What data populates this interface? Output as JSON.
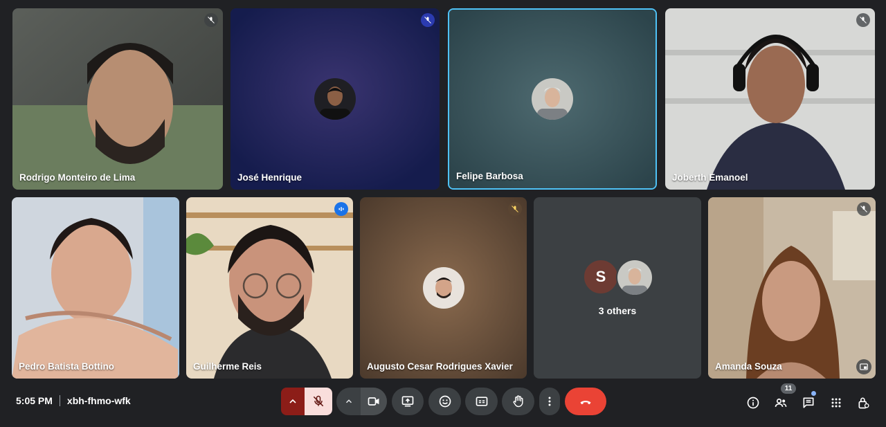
{
  "participants": [
    {
      "name": "Rodrigo Monteiro de Lima",
      "muted": true
    },
    {
      "name": "José Henrique",
      "muted": true
    },
    {
      "name": "Felipe Barbosa",
      "muted": false,
      "active": true
    },
    {
      "name": "Joberth Emanoel",
      "muted": true
    },
    {
      "name": "Pedro Batista Bottino",
      "muted": false
    },
    {
      "name": "Guilherme Reis",
      "muted": false,
      "speaking": true
    },
    {
      "name": "Augusto Cesar Rodrigues Xavier",
      "muted": true
    },
    {
      "name": "Amanda Souza",
      "muted": true
    }
  ],
  "others_tile": {
    "avatar_letter": "S",
    "label": "3 others"
  },
  "meeting": {
    "time": "5:05 PM",
    "code": "xbh-fhmo-wfk"
  },
  "people_count": "11",
  "colors": {
    "background": "#202124",
    "control": "#3c4043",
    "mic_off": "#f9dedc",
    "mic_off_caret": "#8c1d18",
    "hangup": "#ea4335",
    "active_border": "#4fc3f7"
  },
  "controls": [
    "mic-options",
    "mic-toggle",
    "camera-options",
    "camera-toggle",
    "present",
    "reactions",
    "captions",
    "raise-hand",
    "more-options",
    "leave-call"
  ],
  "right_icons": [
    "info-icon",
    "people-icon",
    "chat-icon",
    "activities-icon",
    "host-controls-icon"
  ]
}
